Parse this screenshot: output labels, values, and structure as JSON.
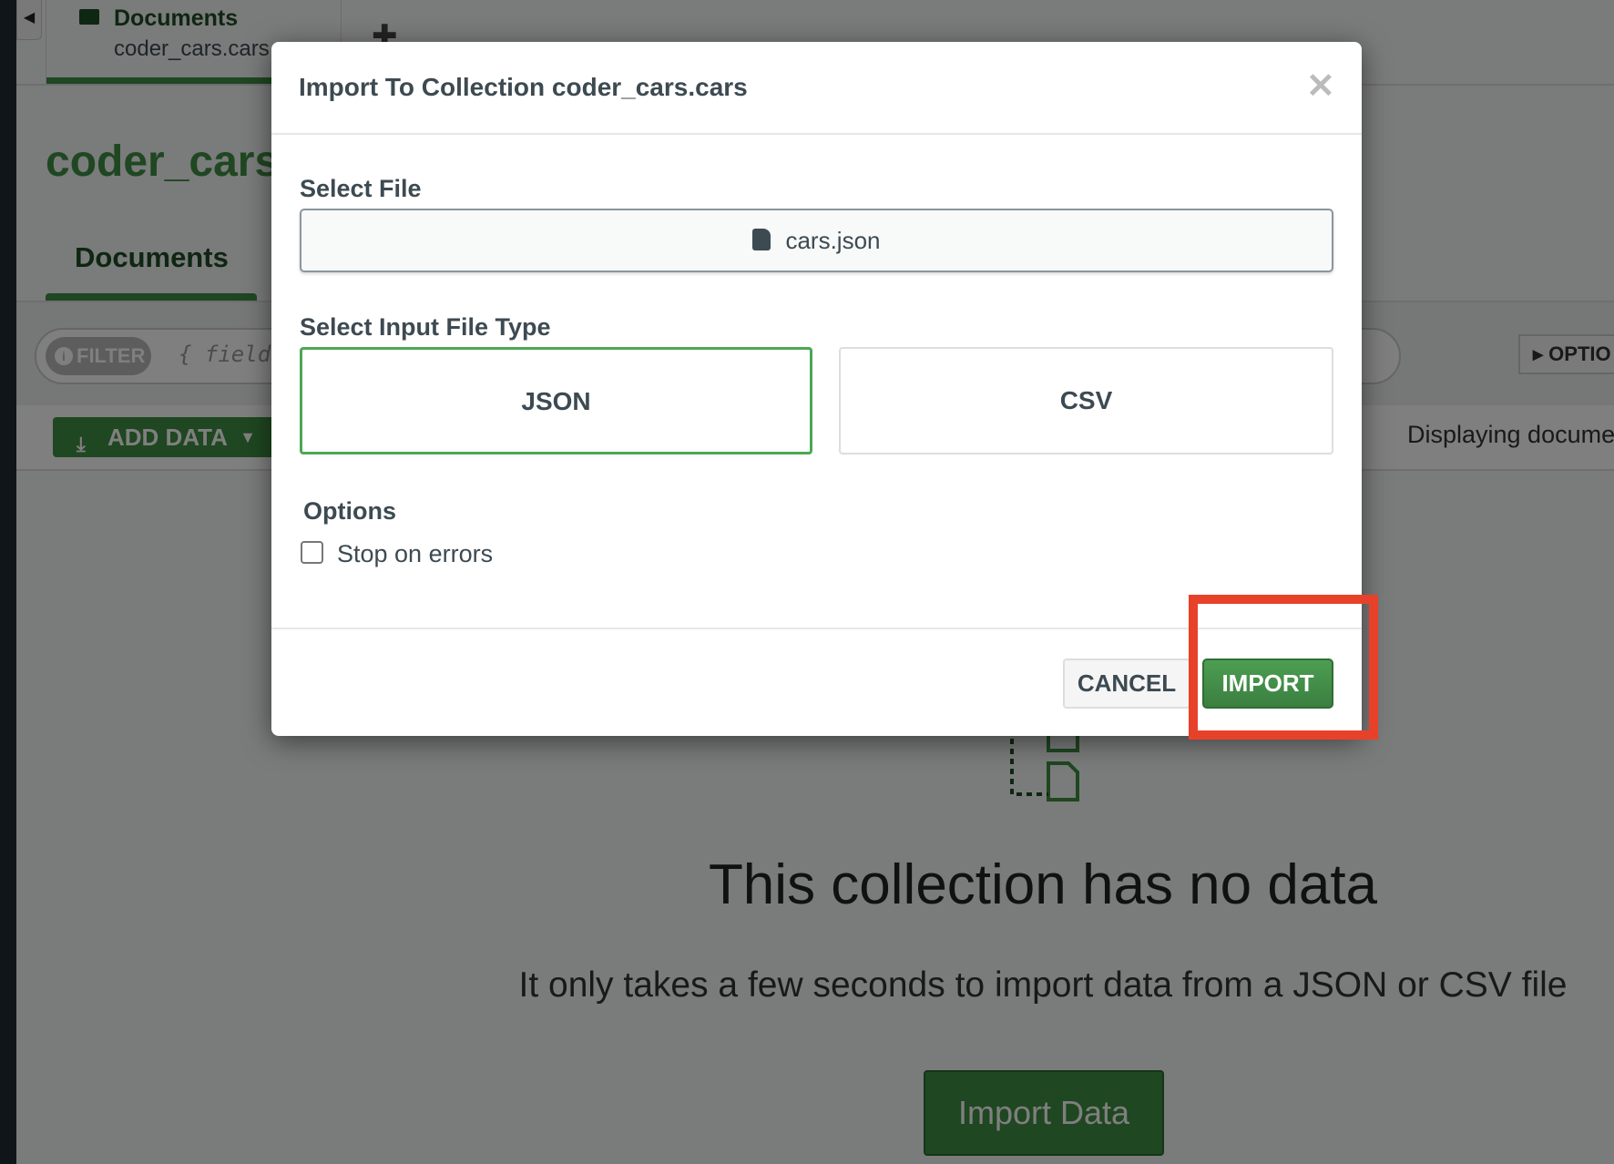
{
  "background": {
    "tab": {
      "title": "Documents",
      "subtitle": "coder_cars.cars"
    },
    "collection_title": "coder_cars.",
    "docs_tab": "Documents",
    "filter": {
      "pill": "FILTER",
      "placeholder": "{ field:"
    },
    "options_label": "OPTIO",
    "add_data_label": "ADD DATA",
    "displaying": "Displaying docume",
    "empty_title": "This collection has no data",
    "empty_subtitle": "It only takes a few seconds to import data from a JSON or CSV file",
    "import_data_label": "Import Data"
  },
  "modal": {
    "title": "Import To Collection coder_cars.cars",
    "select_file_label": "Select File",
    "file_name": "cars.json",
    "file_type_label": "Select Input File Type",
    "types": [
      {
        "label": "JSON",
        "selected": true
      },
      {
        "label": "CSV",
        "selected": false
      }
    ],
    "options_label": "Options",
    "stop_on_errors": {
      "label": "Stop on errors",
      "checked": false
    },
    "cancel_label": "CANCEL",
    "import_label": "IMPORT"
  },
  "colors": {
    "accent": "#3f8f42",
    "highlight": "#e8412a"
  }
}
